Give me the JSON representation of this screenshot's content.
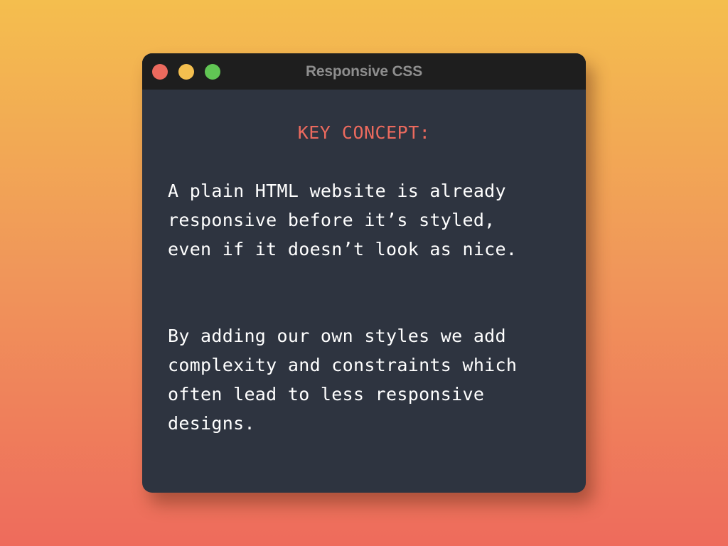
{
  "window": {
    "title": "Responsive CSS",
    "controls": {
      "close_color": "#ec6a5e",
      "minimize_color": "#f4bf4f",
      "maximize_color": "#61c554"
    }
  },
  "content": {
    "heading": "KEY CONCEPT:",
    "paragraph_1": "A plain HTML website is already\nresponsive before it’s styled,\neven if it doesn’t look as nice.",
    "paragraph_2": "By adding our own styles we add\ncomplexity and constraints which\noften lead to less responsive\ndesigns."
  },
  "colors": {
    "background_top": "#f4be4e",
    "background_bottom": "#ee6b5c",
    "window_body": "#2e3440",
    "titlebar": "#1e1e1e",
    "heading_text": "#ec6a5e",
    "body_text": "#ffffff"
  }
}
